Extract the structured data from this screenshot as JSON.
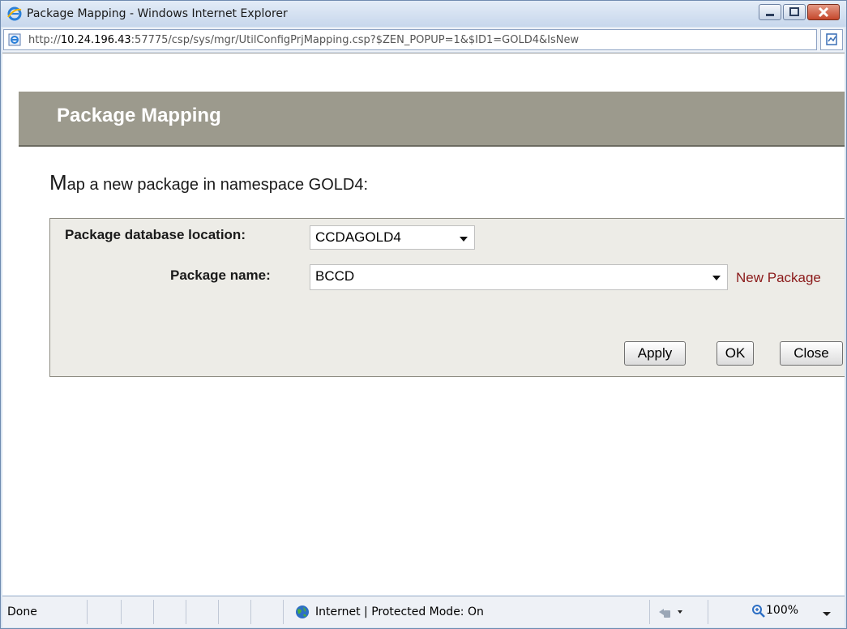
{
  "window": {
    "title": "Package Mapping - Windows Internet Explorer"
  },
  "address": {
    "prefix": "http://",
    "host": "10.24.196.43",
    "rest": ":57775/csp/sys/mgr/UtilConfigPrjMapping.csp?$ZEN_POPUP=1&$ID1=GOLD4&IsNew"
  },
  "page": {
    "header_title": "Package Mapping",
    "intro_first": "M",
    "intro_rest": "ap a new package in namespace GOLD4:",
    "form": {
      "db_location_label": "Package database location:",
      "db_location_value": "CCDAGOLD4",
      "package_name_label": "Package name:",
      "package_name_value": "BCCD",
      "new_package_link": "New Package"
    },
    "buttons": {
      "apply": "Apply",
      "ok": "OK",
      "close": "Close"
    }
  },
  "status": {
    "left": "Done",
    "zone": "Internet | Protected Mode: On",
    "zoom": "100%"
  },
  "colors": {
    "header_bg": "#9c9a8d",
    "link": "#8b1a1a",
    "form_bg": "#edece7"
  }
}
